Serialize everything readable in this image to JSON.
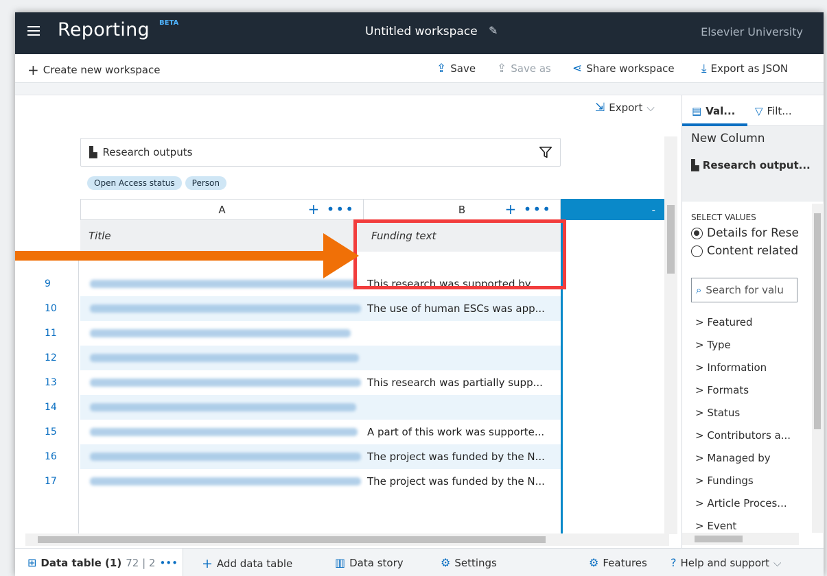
{
  "header": {
    "app_title": "Reporting",
    "beta_badge": "BETA",
    "workspace_title": "Untitled workspace",
    "organization": "Elsevier University"
  },
  "toolbar": {
    "create_new": "Create new workspace",
    "save": "Save",
    "save_as": "Save as",
    "share": "Share workspace",
    "export_json": "Export as JSON"
  },
  "main": {
    "export_label": "Export",
    "source_label": "Research outputs",
    "chips": [
      "Open Access status",
      "Person"
    ],
    "columns": [
      {
        "letter": "A",
        "field": "Title"
      },
      {
        "letter": "B",
        "field": "Funding text"
      },
      {
        "letter": "-"
      }
    ],
    "rows": [
      {
        "num": "9",
        "funding": "This research was supported by ..."
      },
      {
        "num": "10",
        "funding": "The use of human ESCs was app..."
      },
      {
        "num": "11",
        "funding": ""
      },
      {
        "num": "12",
        "funding": ""
      },
      {
        "num": "13",
        "funding": "This research was partially supp..."
      },
      {
        "num": "14",
        "funding": ""
      },
      {
        "num": "15",
        "funding": "A part of this work was supporte..."
      },
      {
        "num": "16",
        "funding": "The project was funded by the N..."
      },
      {
        "num": "17",
        "funding": "The project was funded by the N..."
      }
    ]
  },
  "panel": {
    "tab_values": "Val...",
    "tab_filters": "Filt...",
    "new_column": "New Column",
    "source": "Research output...",
    "select_values_heading": "SELECT VALUES",
    "radio_options": [
      "Details for Rese",
      "Content related"
    ],
    "search_placeholder": "Search for valu",
    "tree_items": [
      "> Featured",
      "> Type",
      "> Information",
      "> Formats",
      "> Status",
      "> Contributors a...",
      "> Managed by",
      "> Fundings",
      "> Article Proces...",
      "> Event"
    ]
  },
  "bottombar": {
    "data_table": "Data table (1)",
    "counts": "72 | 2",
    "more": "•••",
    "add_table": "Add data table",
    "data_story": "Data story",
    "settings": "Settings",
    "features": "Features",
    "help": "Help and support"
  },
  "colors": {
    "topbar": "#1f2a36",
    "accent": "#0a6fc2",
    "selected_column": "#0a89c9",
    "callout": "#f23d3d",
    "arrow": "#f07007"
  }
}
